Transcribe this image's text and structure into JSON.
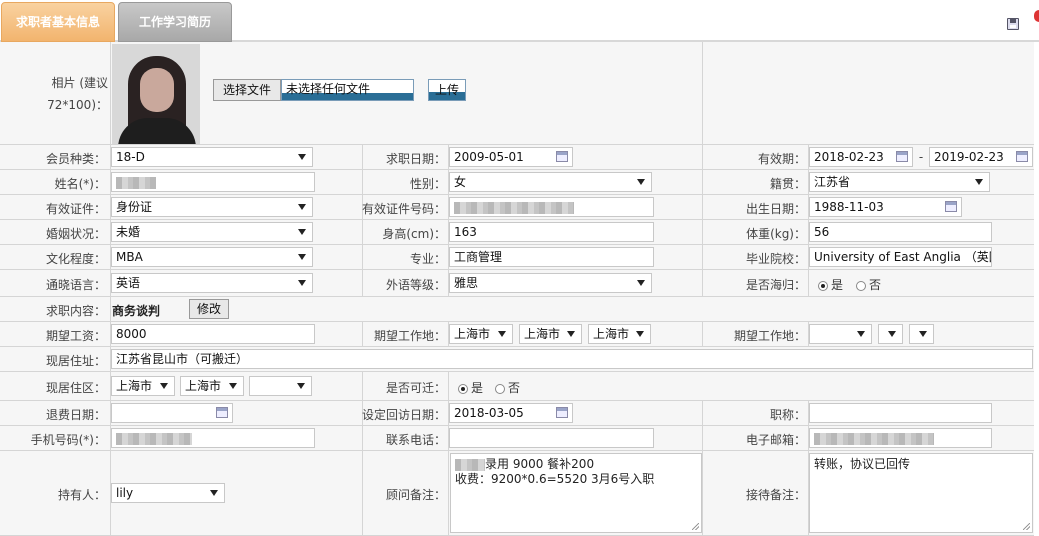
{
  "tabs": [
    "求职者基本信息",
    "工作学习简历"
  ],
  "photo": {
    "label_line1": "相片 (建议",
    "label_line2": "72*100)：",
    "choose_button": "选择文件",
    "no_file": "未选择任何文件",
    "upload_button": "上传"
  },
  "labels": {
    "member_type": "会员种类：",
    "job_date": "求职日期：",
    "valid_period": "有效期：",
    "name": "姓名(*)：",
    "gender": "性别：",
    "native_place": "籍贯：",
    "id_doc": "有效证件：",
    "id_number": "有效证件号码：",
    "birth_date": "出生日期：",
    "marital": "婚姻状况：",
    "height": "身高(cm)：",
    "weight": "体重(kg)：",
    "education": "文化程度：",
    "major": "专业：",
    "school": "毕业院校：",
    "language": "通晓语言：",
    "foreign_level": "外语等级：",
    "returnee": "是否海归：",
    "job_content": "求职内容：",
    "salary": "期望工资：",
    "work_location": "期望工作地：",
    "work_location2": "期望工作地：",
    "address": "现居住址：",
    "residence": "现居住区：",
    "relocate": "是否可迁：",
    "refund_date": "退费日期：",
    "revisit_date": "设定回访日期：",
    "title": "职称：",
    "mobile": "手机号码(*)：",
    "phone": "联系电话：",
    "email": "电子邮箱：",
    "holder": "持有人：",
    "advisor_note": "顾问备注：",
    "reception_note": "接待备注："
  },
  "values": {
    "member_type": "18-D",
    "job_date": "2009-05-01",
    "valid_from": "2018-02-23",
    "valid_sep": "-",
    "valid_to": "2019-02-23",
    "gender": "女",
    "native_place": "江苏省",
    "id_doc": "身份证",
    "birth_date": "1988-11-03",
    "marital": "未婚",
    "height": "163",
    "weight": "56",
    "education": "MBA",
    "major": "工商管理",
    "school": "University of East Anglia （英国",
    "language": "英语",
    "foreign_level": "雅思",
    "yes": "是",
    "no": "否",
    "job_content": "商务谈判",
    "modify_button": "修改",
    "salary": "8000",
    "loc1": "上海市",
    "loc2": "上海市",
    "loc3": "上海市",
    "address": "江苏省昆山市（可搬迁）",
    "res1": "上海市",
    "res2": "上海市",
    "revisit_date": "2018-03-05",
    "holder": "lily",
    "advisor_line1": "录用 9000 餐补200",
    "advisor_line2": "收费：9200*0.6=5520 3月6号入职",
    "reception_note": "转账，协议已回传"
  }
}
